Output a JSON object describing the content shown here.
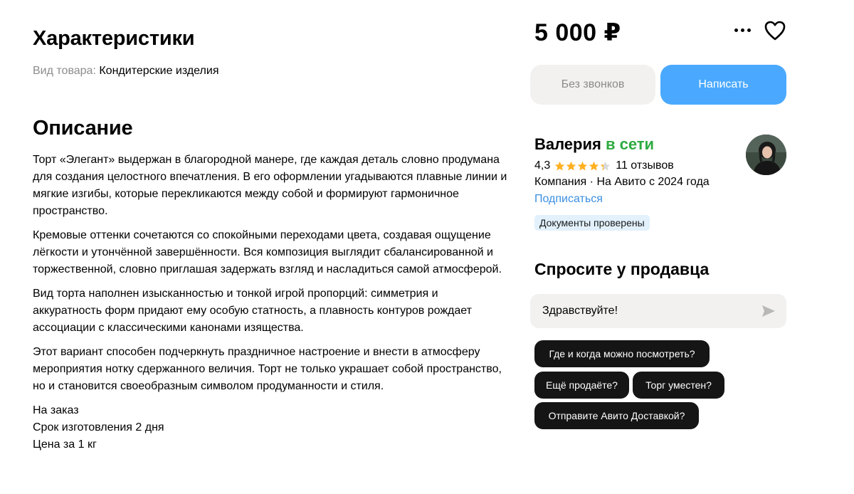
{
  "characteristics": {
    "title": "Характеристики",
    "product_type_key": "Вид товара:",
    "product_type_value": "Кондитерские изделия"
  },
  "description": {
    "title": "Описание",
    "paragraphs": [
      "Торт «Элегант» выдержан в благородной манере, где каждая деталь словно продумана для создания целостного впечатления. В его оформлении угадываются плавные линии и мягкие изгибы, которые перекликаются между собой и формируют гармоничное пространство.",
      "Кремовые оттенки сочетаются со спокойными переходами цвета, создавая ощущение лёгкости и утончённой завершённости. Вся композиция выглядит сбалансированной и торжественной, словно приглашая задержать взгляд и насладиться самой атмосферой.",
      "Вид торта наполнен изысканностью и тонкой игрой пропорций: симметрия и аккуратность форм придают ему особую статность, а плавность контуров рождает ассоциации с классическими канонами изящества.",
      "Этот вариант способен подчеркнуть праздничное настроение и внести в атмосферу мероприятия нотку сдержанного величия. Торт не только украшает собой пространство, но и становится своеобразным символом продуманности и стиля."
    ],
    "extra_lines": [
      "На заказ",
      "Срок изготовления 2 дня",
      "Цена за 1 кг"
    ]
  },
  "price": "5 000 ₽",
  "actions": {
    "more_icon": "more-horizontal-icon",
    "favorite_icon": "heart-icon",
    "no_calls_label": "Без звонков",
    "write_label": "Написать"
  },
  "seller": {
    "name": "Валерия",
    "status": "в сети",
    "rating": "4,3",
    "stars": 4.3,
    "reviews": "11 отзывов",
    "meta": "Компания · На Авито с 2024 года",
    "subscribe_label": "Подписаться",
    "badge": "Документы проверены"
  },
  "ask": {
    "title": "Спросите у продавца",
    "message_value": "Здравствуйте!",
    "send_icon": "send-icon",
    "quick_questions": [
      "Где и когда можно посмотреть?",
      "Ещё продаёте?",
      "Торг уместен?",
      "Отправите Авито Доставкой?"
    ]
  },
  "colors": {
    "accent_blue": "#4aa9ff",
    "online_green": "#2daa40",
    "link_blue": "#3b8fe0",
    "star_yellow": "#ffb021",
    "chip_dark": "#151515",
    "button_gray": "#f2f1f0",
    "badge_bg": "#e2f1fc"
  }
}
